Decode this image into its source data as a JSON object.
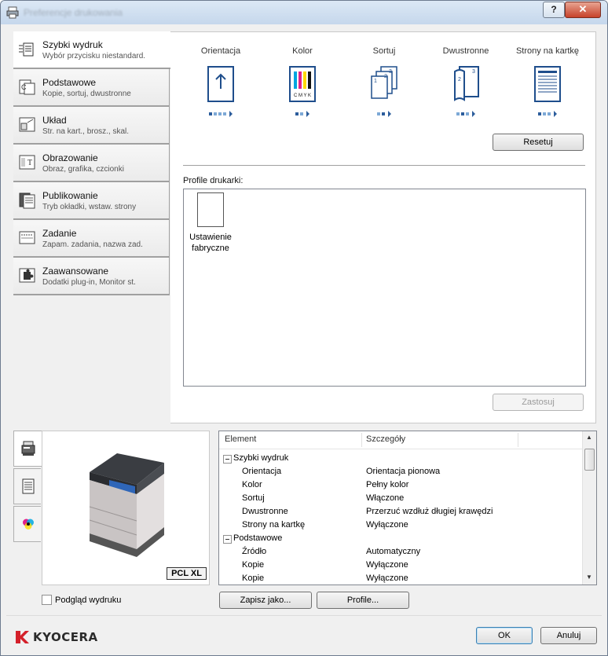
{
  "window": {
    "title": "Preferencje drukowania",
    "help_label": "?",
    "close_label": "✕"
  },
  "nav": {
    "items": [
      {
        "title": "Szybki wydruk",
        "subtitle": "Wybór przycisku niestandard.",
        "icon": "quick-print-icon",
        "selected": true
      },
      {
        "title": "Podstawowe",
        "subtitle": "Kopie, sortuj, dwustronne",
        "icon": "basic-icon",
        "selected": false
      },
      {
        "title": "Układ",
        "subtitle": "Str. na kart., brosz., skal.",
        "icon": "layout-icon",
        "selected": false
      },
      {
        "title": "Obrazowanie",
        "subtitle": "Obraz, grafika, czcionki",
        "icon": "imaging-icon",
        "selected": false
      },
      {
        "title": "Publikowanie",
        "subtitle": "Tryb okładki, wstaw. strony",
        "icon": "publishing-icon",
        "selected": false
      },
      {
        "title": "Zadanie",
        "subtitle": "Zapam. zadania, nazwa zad.",
        "icon": "job-icon",
        "selected": false
      },
      {
        "title": "Zaawansowane",
        "subtitle": "Dodatki plug-in, Monitor st.",
        "icon": "puzzle-icon",
        "selected": false
      }
    ]
  },
  "quick": {
    "columns": [
      {
        "label": "Orientacja",
        "icon": "orientation-icon",
        "dots": 4,
        "active": 0
      },
      {
        "label": "Kolor",
        "icon": "color-cmyk-icon",
        "dots": 2,
        "active": 0
      },
      {
        "label": "Sortuj",
        "icon": "collate-icon",
        "dots": 2,
        "active": 1
      },
      {
        "label": "Dwustronne",
        "icon": "duplex-icon",
        "dots": 3,
        "active": 1
      },
      {
        "label": "Strony na kartkę",
        "icon": "pages-per-sheet-icon",
        "dots": 3,
        "active": 0
      }
    ],
    "reset_label": "Resetuj",
    "profiles_label": "Profile drukarki:",
    "profile_item_line1": "Ustawienie",
    "profile_item_line2": "fabryczne",
    "apply_label": "Zastosuj"
  },
  "preview": {
    "badge": "PCL XL",
    "checkbox_label": "Podgląd wydruku"
  },
  "details": {
    "header_element": "Element",
    "header_details": "Szczegóły",
    "rows": [
      {
        "type": "group",
        "element": "Szybki wydruk",
        "detail": ""
      },
      {
        "type": "item",
        "element": "Orientacja",
        "detail": "Orientacja pionowa"
      },
      {
        "type": "item",
        "element": "Kolor",
        "detail": "Pełny kolor"
      },
      {
        "type": "item",
        "element": "Sortuj",
        "detail": "Włączone"
      },
      {
        "type": "item",
        "element": "Dwustronne",
        "detail": "Przerzuć wzdłuż długiej krawędzi"
      },
      {
        "type": "item",
        "element": "Strony na kartkę",
        "detail": "Wyłączone"
      },
      {
        "type": "group",
        "element": "Podstawowe",
        "detail": ""
      },
      {
        "type": "item",
        "element": "Źródło",
        "detail": "Automatyczny"
      },
      {
        "type": "item",
        "element": "Kopie",
        "detail": "Wyłączone"
      },
      {
        "type": "item",
        "element": "Kopie",
        "detail": "Wyłączone"
      }
    ]
  },
  "buttons": {
    "save_as": "Zapisz jako...",
    "profiles": "Profile...",
    "ok": "OK",
    "cancel": "Anuluj"
  },
  "brand": {
    "name": "KYOCERA",
    "color": "#d4202a"
  }
}
